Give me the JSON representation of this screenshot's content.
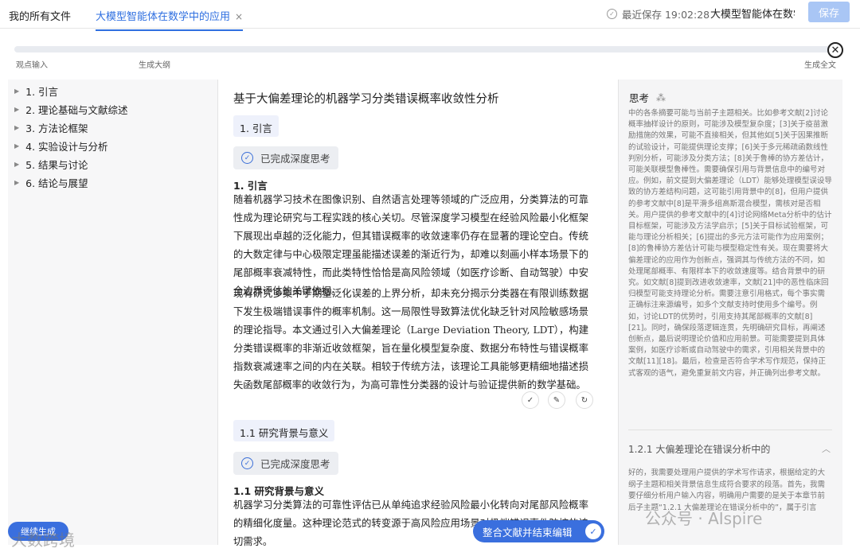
{
  "header": {
    "all_files": "我的所有文件",
    "doc_tab": "大模型智能体在数学中的应用",
    "tab_close": "×",
    "last_saved": "最近保存 19:02:28",
    "title_input": "大模型智能体在数学中的应用",
    "save_label": "保存"
  },
  "steps": {
    "s1": "观点输入",
    "s2": "生成大纲",
    "s3": "生成全文"
  },
  "outline": [
    {
      "label": "1. 引言"
    },
    {
      "label": "2. 理论基础与文献综述"
    },
    {
      "label": "3. 方法论框架"
    },
    {
      "label": "4. 实验设计与分析"
    },
    {
      "label": "5. 结果与讨论"
    },
    {
      "label": "6. 结论与展望"
    }
  ],
  "doc": {
    "title": "基于大偏差理论的机器学习分类错误概率收敛性分析",
    "sec1_pill": "1. 引言",
    "think_done": "已完成深度思考",
    "sec1_head": "1. 引言",
    "sec1_p1": "随着机器学习技术在图像识别、自然语言处理等领域的广泛应用，分类算法的可靠性成为理论研究与工程实践的核心关切。尽管深度学习模型在经验风险最小化框架下展现出卓越的泛化能力，但其错误概率的收敛速率仍存在显著的理论空白。传统的大数定律与中心极限定理虽能描述误差的渐近行为，却难以刻画小样本场景下的尾部概率衰减特性，而此类特性恰恰是高风险领域（如医疗诊断、自动驾驶）中安全边界评估的关键依据。",
    "sec1_p2": "现有研究多集中于期望泛化误差的上界分析，却未充分揭示分类器在有限训练数据下发生极端错误事件的概率机制。这一局限性导致算法优化缺乏针对风险敏感场景的理论指导。本文通过引入大偏差理论（Large Deviation Theory, LDT），构建分类错误概率的非渐近收敛框架，旨在量化模型复杂度、数据分布特性与错误概率指数衰减速率之间的内在关联。相较于传统方法，该理论工具能够更精细地描述损失函数尾部概率的收敛行为，为高可靠性分类器的设计与验证提供新的数学基础。",
    "sec11_pill": "1.1 研究背景与意义",
    "think_done_2": "已完成深度思考",
    "sec11_head": "1.1 研究背景与意义",
    "sec11_p1": "机器学习分类算法的可靠性评估已从单纯追求经验风险最小化转向对尾部风险概率的精细化度量。这种理论范式的转变源于高风险应用场景对极端错误事件防控的迫切需求。"
  },
  "actions": {
    "accept": "✓",
    "pin": "✎",
    "refresh": "↻"
  },
  "thinking": {
    "title": "思考",
    "spinner": "⁂",
    "text": "中的各条摘要可能与当前子主题相关。比如参考文献[2]讨论概率抽样设计的原则，可能涉及模型复杂度；[3]关于疫苗激励措施的效果，可能不直接相关，但其他如[5]关于因果推断的试验设计，可能提供理论支撑；[6]关于多元稀疏函数线性判别分析，可能涉及分类方法；[8]关于鲁棒的协方差估计，可能关联模型鲁棒性。需要确保引用与背景信息中的编号对应。例如，前文提到大偏差理论（LDT）能够处理模型误设导致的协方差结构问题，这可能引用背景中的[8]，但用户提供的参考文献中[8]是平滑多组高斯混合模型，需核对是否相关。用户提供的参考文献中的[4]讨论网络Meta分析中的估计目标框架，可能涉及方法学启示；[5]关于目标试验框架，可能与理论分析相关；[6]提出的多元方法可能作为应用案例；[8]的鲁棒协方差估计可能与模型稳定性有关。现在需要将大偏差理论的应用作为创新点，强调其与传统方法的不同，如处理尾部概率、有限样本下的收敛速度等。结合背景中的研究。如文献[8]提到改进收敛速率，文献[21]中的恶性临床回归模型可能支持理论分析。需要注意引用格式，每个事实需正确标注来源编号，如多个文献支持时使用多个编号。例如，讨论LDT的优势时，引用支持其尾部概率的文献[8][21]。同时，确保段落逻辑连贯，先明确研究目标，再阐述创新点，最后说明理论价值和应用前景。可能需要提到具体案例，如医疗诊断或自动驾驶中的需求，引用相关背景中的文献[11][18]。最后，检查是否符合学术写作规范，保持正式客观的语气，避免重复前文内容，并正确列出参考文献。",
    "sub_title": "1.2.1 大偏差理论在错误分析中的",
    "sub_toggle": "︿",
    "sub_text": "好的，我需要处理用户提供的学术写作请求，根据给定的大纲子主题和相关背景信息生成符合要求的段落。首先，我需要仔细分析用户输入内容，明确用户需要的是关于本章节前后子主题“1.2.1 大偏差理论在错误分析中的”，属于引言"
  },
  "bottom": {
    "merge_label": "整合文献并结束编辑",
    "merge_ok": "✓",
    "continue_label": "继续生成"
  },
  "watermarks": {
    "left": "大数跨境",
    "right": "公众号 · AIspire"
  }
}
